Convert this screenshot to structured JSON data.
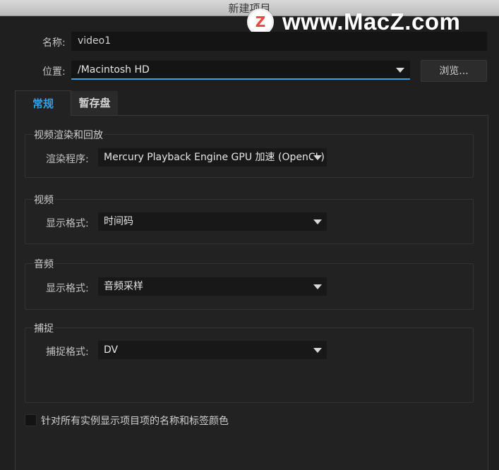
{
  "window": {
    "title": "新建项目"
  },
  "watermark": {
    "logo_letter": "Z",
    "text": "www.MacZ.com"
  },
  "name_field": {
    "label": "名称:",
    "value": "video1"
  },
  "location_field": {
    "label": "位置:",
    "value": "/Macintosh HD"
  },
  "browse_button": {
    "label": "浏览..."
  },
  "tabs": [
    {
      "label": "常规",
      "active": true
    },
    {
      "label": "暂存盘",
      "active": false
    }
  ],
  "groups": {
    "render": {
      "title": "视频渲染和回放",
      "setting_label": "渲染程序:",
      "setting_value": "Mercury Playback Engine GPU 加速 (OpenCL)"
    },
    "video": {
      "title": "视频",
      "setting_label": "显示格式:",
      "setting_value": "时间码"
    },
    "audio": {
      "title": "音频",
      "setting_label": "显示格式:",
      "setting_value": "音频采样"
    },
    "capture": {
      "title": "捕捉",
      "setting_label": "捕捉格式:",
      "setting_value": "DV"
    }
  },
  "checkbox": {
    "label": "针对所有实例显示项目项的名称和标签颜色",
    "checked": false
  },
  "colors": {
    "accent": "#3aa0e4",
    "background": "#1f1f1f",
    "panel": "#222222"
  }
}
